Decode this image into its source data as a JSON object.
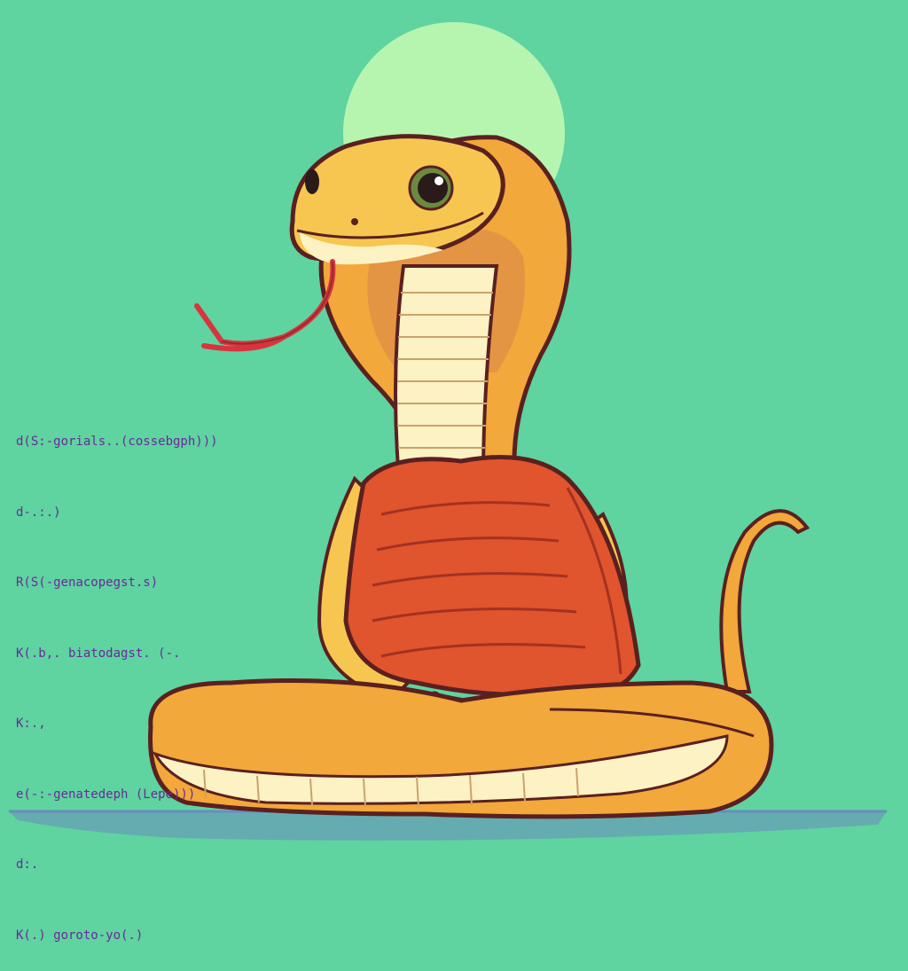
{
  "scene": {
    "subject": "cartoon cobra in orange monk robe, meditating cross-legged",
    "palette": {
      "background": "#5fd3a0",
      "halo": "#b6f5b0",
      "snake_body": "#f2a83a",
      "snake_highlight": "#f7c651",
      "belly": "#fdf2c4",
      "robe": "#e0542e",
      "robe_shadow": "#c23f2a",
      "tongue": "#d8343e",
      "outline": "#5a2020",
      "text": "#6a2a9a",
      "shadow": "#6a8cc0"
    }
  },
  "code_lines": [
    "d(S:-gorials..(cossebgph)))",
    "d-.:.)",
    "R(S(-genacopegst.s)",
    "K(.b,. biatodagst. (-.",
    "K:.,",
    "e(-:-genatedeph (Lepe)))",
    "d:.",
    "K(.) goroto-yo(.)"
  ]
}
